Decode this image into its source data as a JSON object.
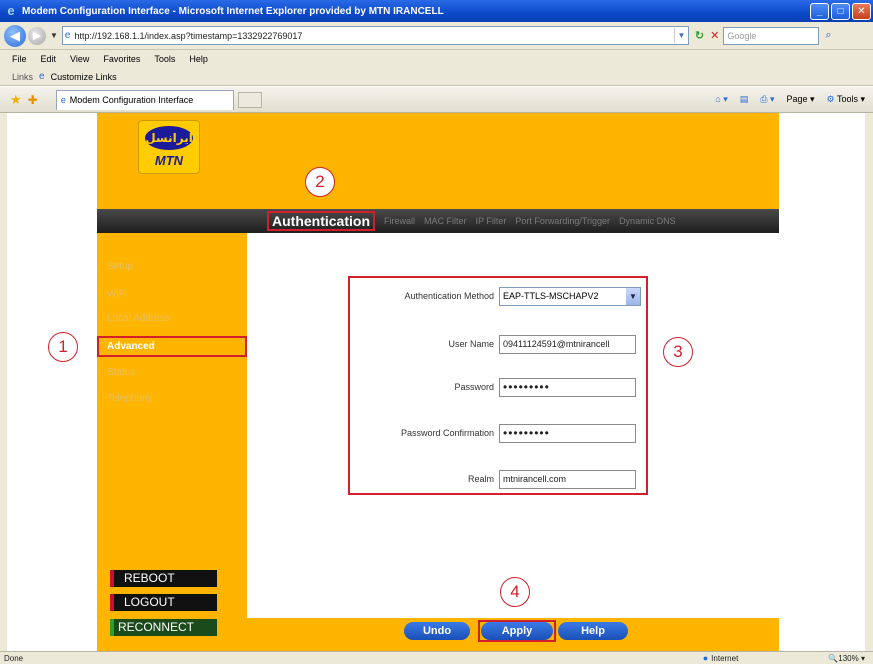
{
  "window": {
    "title": "Modem Configuration Interface - Microsoft Internet Explorer provided by MTN IRANCELL",
    "minimize": "_",
    "maximize": "□",
    "close": "✕"
  },
  "address_bar": {
    "url": "http://192.168.1.1/index.asp?timestamp=1332922769017",
    "search_placeholder": "Google"
  },
  "menu": [
    "File",
    "Edit",
    "View",
    "Favorites",
    "Tools",
    "Help"
  ],
  "links_bar": {
    "label": "Links",
    "item": "Customize Links"
  },
  "tab": {
    "label": "Modem Configuration Interface",
    "page_label": "Page",
    "tools_label": "Tools"
  },
  "logo": {
    "farsi": "ایرانسل",
    "brand": "MTN"
  },
  "top_nav": {
    "active": "Authentication",
    "items": [
      "Firewall",
      "MAC Filter",
      "IP Filter",
      "Port Forwarding/Trigger",
      "Dynamic DNS"
    ]
  },
  "sidebar": {
    "items": [
      "Setup",
      "WiFi",
      "Local Address",
      "Advanced",
      "Status",
      "Telephony"
    ],
    "active_index": 3,
    "buttons": {
      "reboot": "REBOOT",
      "logout": "LOGOUT",
      "reconnect": "RECONNECT"
    }
  },
  "form": {
    "auth_method": {
      "label": "Authentication Method",
      "value": "EAP-TTLS-MSCHAPV2"
    },
    "username": {
      "label": "User Name",
      "value": "09411124591@mtnirancell"
    },
    "password": {
      "label": "Password",
      "value": "•••••••••"
    },
    "password_confirm": {
      "label": "Password Confirmation",
      "value": "•••••••••"
    },
    "realm": {
      "label": "Realm",
      "value": "mtnirancell.com"
    }
  },
  "actions": {
    "undo": "Undo",
    "apply": "Apply",
    "help": "Help"
  },
  "callouts": [
    "1",
    "2",
    "3",
    "4"
  ],
  "status_bar": {
    "left": "Done",
    "zone": "Internet",
    "zoom": "130%"
  },
  "colors": {
    "mtn_yellow": "#ffb400",
    "highlight_red": "#d21f2a",
    "nav_dark": "#2a2a2a",
    "button_blue": "#1a4fb6"
  }
}
